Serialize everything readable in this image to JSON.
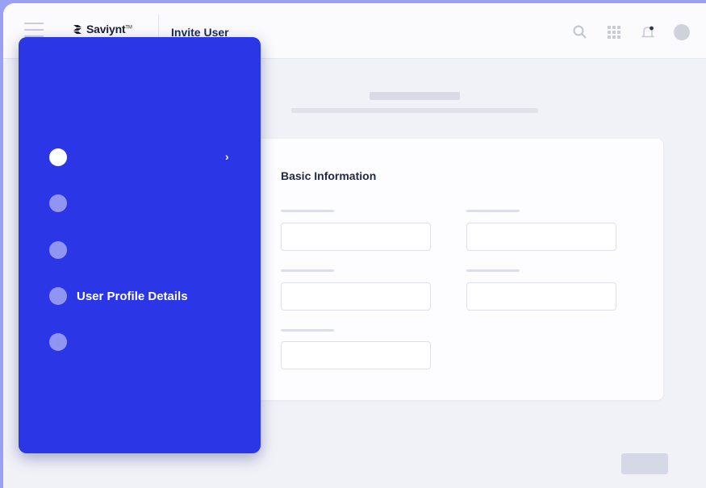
{
  "app": {
    "brand": "Saviynt",
    "brand_mark": "TM",
    "page_heading": "Invite User"
  },
  "topbar": {
    "icons": [
      "search-icon",
      "apps-grid-icon",
      "notification-bell-icon",
      "user-avatar"
    ]
  },
  "form": {
    "section_title": "Basic Information",
    "fields": [
      {
        "value": "",
        "placeholder": ""
      },
      {
        "value": "",
        "placeholder": ""
      },
      {
        "value": "",
        "placeholder": ""
      },
      {
        "value": "",
        "placeholder": ""
      },
      {
        "value": "",
        "placeholder": ""
      }
    ]
  },
  "stepper": {
    "active_index": 0,
    "steps": [
      {
        "label": ""
      },
      {
        "label": ""
      },
      {
        "label": ""
      },
      {
        "label": "User Profile Details"
      },
      {
        "label": ""
      }
    ]
  },
  "colors": {
    "panel": "#2b37e6",
    "step_inactive": "#8f95f1",
    "step_active": "#ffffff",
    "background_frame": "#9aa0f4"
  }
}
